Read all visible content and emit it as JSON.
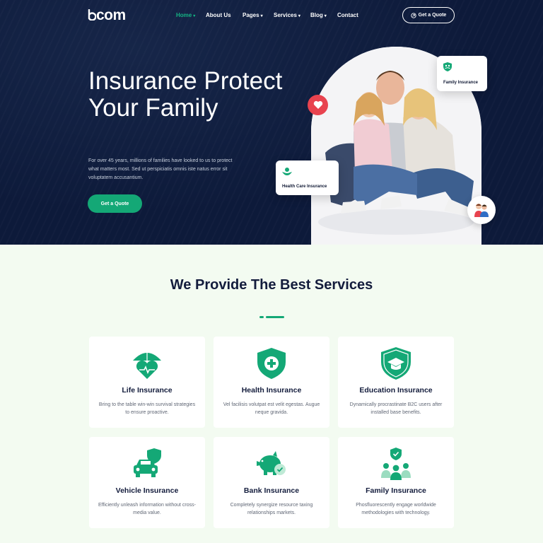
{
  "nav": {
    "logo": "com",
    "items": [
      {
        "label": "Home",
        "has_caret": true,
        "active": true
      },
      {
        "label": "About Us",
        "has_caret": false
      },
      {
        "label": "Pages",
        "has_caret": true
      },
      {
        "label": "Services",
        "has_caret": true
      },
      {
        "label": "Blog",
        "has_caret": true
      },
      {
        "label": "Contact",
        "has_caret": false
      }
    ],
    "quote_label": "Get a Quote"
  },
  "hero": {
    "title": "Insurance Protect Your Family",
    "description": "For over 45 years, millions of families have looked to us to protect what matters most. Sed ut perspiciatis omnis iste natus error sit voluptatem accusantium.",
    "cta_label": "Get a Quote",
    "badges": {
      "family": "Family Insurance",
      "health": "Health Care Insurance"
    }
  },
  "services": {
    "title": "We Provide The Best Services",
    "items": [
      {
        "name": "Life Insurance",
        "desc": "Bring to the table win-win survival strategies to ensure proactive.",
        "icon": "umbrella-heart-icon"
      },
      {
        "name": "Health Insurance",
        "desc": "Vel facilisis volutpat est velit egestas. Augue neque gravida.",
        "icon": "shield-plus-icon"
      },
      {
        "name": "Education Insurance",
        "desc": "Dynamically procrastinate B2C users after installed base benefits.",
        "icon": "shield-graduation-icon"
      },
      {
        "name": "Vehicle Insurance",
        "desc": "Efficiently unleash information without cross-media value.",
        "icon": "car-shield-icon"
      },
      {
        "name": "Bank Insurance",
        "desc": "Completely synergize resource taxing relationships markets.",
        "icon": "piggy-bank-icon"
      },
      {
        "name": "Family Insurance",
        "desc": "Phosfluorescently engage worldwide methodologies with technology.",
        "icon": "family-shield-icon"
      }
    ]
  },
  "colors": {
    "navy": "#0d1a3a",
    "accent": "#14a876",
    "heart": "#e8434f",
    "section_bg": "#f3fbf1"
  }
}
